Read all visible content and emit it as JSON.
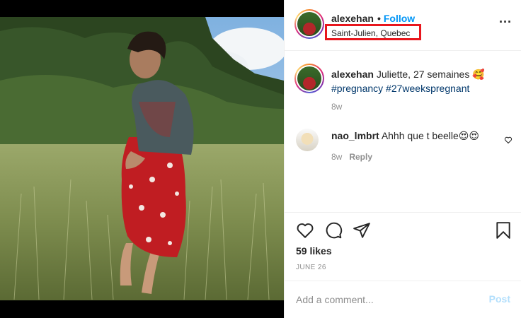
{
  "post": {
    "username": "alexehan",
    "follow_label": "Follow",
    "separator": "•",
    "location": "Saint-Julien, Quebec",
    "more_icon": "more-horizontal-icon",
    "more_glyph": "···"
  },
  "caption": {
    "username": "alexehan",
    "text": "Juliette, 27 semaines 🥰",
    "hashtags": "#pregnancy #27weekspregnant",
    "time": "8w"
  },
  "comments": [
    {
      "username": "nao_lmbrt",
      "text": "Ahhh que t beelle😍😍",
      "time": "8w",
      "reply_label": "Reply",
      "like_icon": "heart-outline-icon"
    }
  ],
  "actions": {
    "icons": [
      "heart-icon",
      "comment-icon",
      "share-icon",
      "bookmark-icon"
    ],
    "likes": "59 likes",
    "date": "JUNE 26"
  },
  "add_comment": {
    "placeholder": "Add a comment...",
    "post_label": "Post"
  },
  "colors": {
    "link_blue": "#0095f6",
    "hashtag": "#00376b",
    "highlight_box": "#e8161d",
    "muted": "#8e8e8e"
  }
}
